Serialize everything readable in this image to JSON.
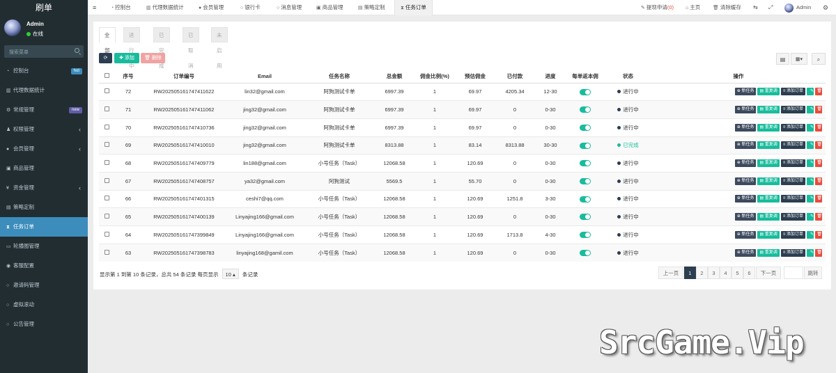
{
  "app": {
    "title": "刷单"
  },
  "user": {
    "name": "Admin",
    "status": "在线"
  },
  "sidebar": {
    "search_placeholder": "搜索菜单",
    "items": [
      {
        "label": "控制台",
        "icon": "dashboard-icon",
        "badge": "hot",
        "badge_color": "#3c8dbc"
      },
      {
        "label": "代理数据统计",
        "icon": "bar-chart-icon"
      },
      {
        "label": "常规管理",
        "icon": "gear-icon",
        "badge": "new",
        "badge_color": "#605ca8"
      },
      {
        "label": "权限管理",
        "icon": "group-icon",
        "arrow": "‹"
      },
      {
        "label": "会员管理",
        "icon": "user-icon",
        "arrow": "‹"
      },
      {
        "label": "商品管理",
        "icon": "product-icon"
      },
      {
        "label": "资金管理",
        "icon": "yen-icon",
        "arrow": "‹"
      },
      {
        "label": "策略定制",
        "icon": "chart-icon"
      },
      {
        "label": "任务订单",
        "icon": "hourglass-icon",
        "active": true
      },
      {
        "label": "轮播图管理",
        "icon": "image-icon"
      },
      {
        "label": "客服配置",
        "icon": "headset-icon"
      },
      {
        "label": "邀请码管理",
        "icon": "circle-icon"
      },
      {
        "label": "虚拟滚动",
        "icon": "circle-icon"
      },
      {
        "label": "公告管理",
        "icon": "circle-icon"
      }
    ]
  },
  "topbar": {
    "tabs": [
      "控制台",
      "代理数据统计",
      "会员管理",
      "银行卡",
      "消息管理",
      "商品管理",
      "策略定制",
      "任务订单"
    ],
    "withdraw_label": "提现申请",
    "withdraw_count": "(0)",
    "home_label": "主页",
    "clear_cache_label": "清除缓存",
    "admin_label": "Admin"
  },
  "subtabs": [
    "全部",
    "进行中",
    "已完成",
    "已取消",
    "未启用"
  ],
  "toolbar": {
    "add_label": "添加",
    "delete_label": "删除"
  },
  "table": {
    "headers": [
      "序号",
      "订单编号",
      "Email",
      "任务名称",
      "总金额",
      "佣金比例(%)",
      "预估佣金",
      "已付款",
      "进度",
      "每单返本佣",
      "状态",
      "操作"
    ],
    "actions": {
      "new_task": "新任务",
      "repeat": "重复调",
      "add_order": "添加订单"
    },
    "rows": [
      {
        "id": "72",
        "order_no": "RW202505161747411622",
        "email": "lin32@gmail.com",
        "task": "阿狗测试卡单",
        "total": "6997.39",
        "rate": "1",
        "commission": "69.97",
        "paid": "4205.34",
        "progress": "12-30",
        "status": "进行中"
      },
      {
        "id": "71",
        "order_no": "RW202505161747411062",
        "email": "jing32@gmail.com",
        "task": "阿狗测试卡单",
        "total": "6997.39",
        "rate": "1",
        "commission": "69.97",
        "paid": "0",
        "progress": "0-30",
        "status": "进行中"
      },
      {
        "id": "70",
        "order_no": "RW202505161747410736",
        "email": "jing32@gmail.com",
        "task": "阿狗测试卡单",
        "total": "6997.39",
        "rate": "1",
        "commission": "69.97",
        "paid": "0",
        "progress": "0-30",
        "status": "进行中"
      },
      {
        "id": "69",
        "order_no": "RW202505161747410010",
        "email": "jing32@gmail.com",
        "task": "阿狗测试卡单",
        "total": "8313.88",
        "rate": "1",
        "commission": "83.14",
        "paid": "8313.88",
        "progress": "30-30",
        "status": "已完成"
      },
      {
        "id": "68",
        "order_no": "RW202505161747409779",
        "email": "lin188@gmail.com",
        "task": "小号任务（Task）",
        "total": "12068.58",
        "rate": "1",
        "commission": "120.69",
        "paid": "0",
        "progress": "0-30",
        "status": "进行中"
      },
      {
        "id": "67",
        "order_no": "RW202505161747408757",
        "email": "ya32@gmail.com",
        "task": "阿狗测试",
        "total": "5569.5",
        "rate": "1",
        "commission": "55.70",
        "paid": "0",
        "progress": "0-30",
        "status": "进行中"
      },
      {
        "id": "66",
        "order_no": "RW202505161747401315",
        "email": "ceshi7@qq.com",
        "task": "小号任务（Task）",
        "total": "12068.58",
        "rate": "1",
        "commission": "120.69",
        "paid": "1251.8",
        "progress": "3-30",
        "status": "进行中"
      },
      {
        "id": "65",
        "order_no": "RW202505161747400139",
        "email": "Linyajing166@gmail.com",
        "task": "小号任务（Task）",
        "total": "12068.58",
        "rate": "1",
        "commission": "120.69",
        "paid": "0",
        "progress": "0-30",
        "status": "进行中"
      },
      {
        "id": "64",
        "order_no": "RW202505161747399849",
        "email": "Linyajing166@gmail.com",
        "task": "小号任务（Task）",
        "total": "12068.58",
        "rate": "1",
        "commission": "120.69",
        "paid": "1713.8",
        "progress": "4-30",
        "status": "进行中"
      },
      {
        "id": "63",
        "order_no": "RW202505161747398783",
        "email": "linyajing168@gamil.com",
        "task": "小号任务（Task）",
        "total": "12068.58",
        "rate": "1",
        "commission": "120.69",
        "paid": "0",
        "progress": "0-30",
        "status": "进行中"
      }
    ]
  },
  "footer": {
    "info": "显示第 1 到第 10 条记录，总共 54 条记录 每页显示",
    "page_size": "10",
    "suffix": "条记录"
  },
  "pagination": {
    "prev": "上一页",
    "pages": [
      "1",
      "2",
      "3",
      "4",
      "5",
      "6"
    ],
    "current": "1",
    "next": "下一页",
    "jump": "跳转"
  },
  "colors": {
    "sidebar": "#222d32",
    "active": "#3c8dbc",
    "success": "#18bc9c",
    "danger": "#e74c3c",
    "primary": "#2c3e50",
    "status_running": "#2c3e50",
    "status_done": "#18bc9c"
  },
  "watermark": "SrcGame.Vip"
}
